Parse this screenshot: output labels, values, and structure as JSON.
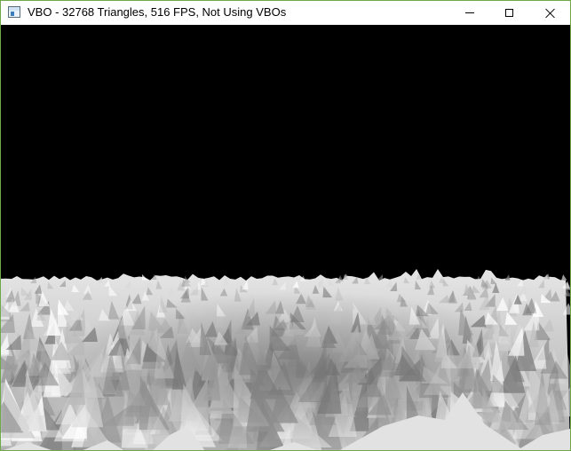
{
  "window": {
    "title": "VBO - 32768 Triangles, 516 FPS, Not Using VBOs",
    "icon": "app-window-icon",
    "controls": {
      "minimize": "minimize-icon",
      "maximize": "maximize-icon",
      "close": "close-icon"
    }
  },
  "viewport": {
    "background_color": "#000000",
    "terrain_colors": [
      "#ffffff",
      "#d9d9d9",
      "#bdbdbd",
      "#9a9a9a",
      "#7d7d7d"
    ]
  }
}
